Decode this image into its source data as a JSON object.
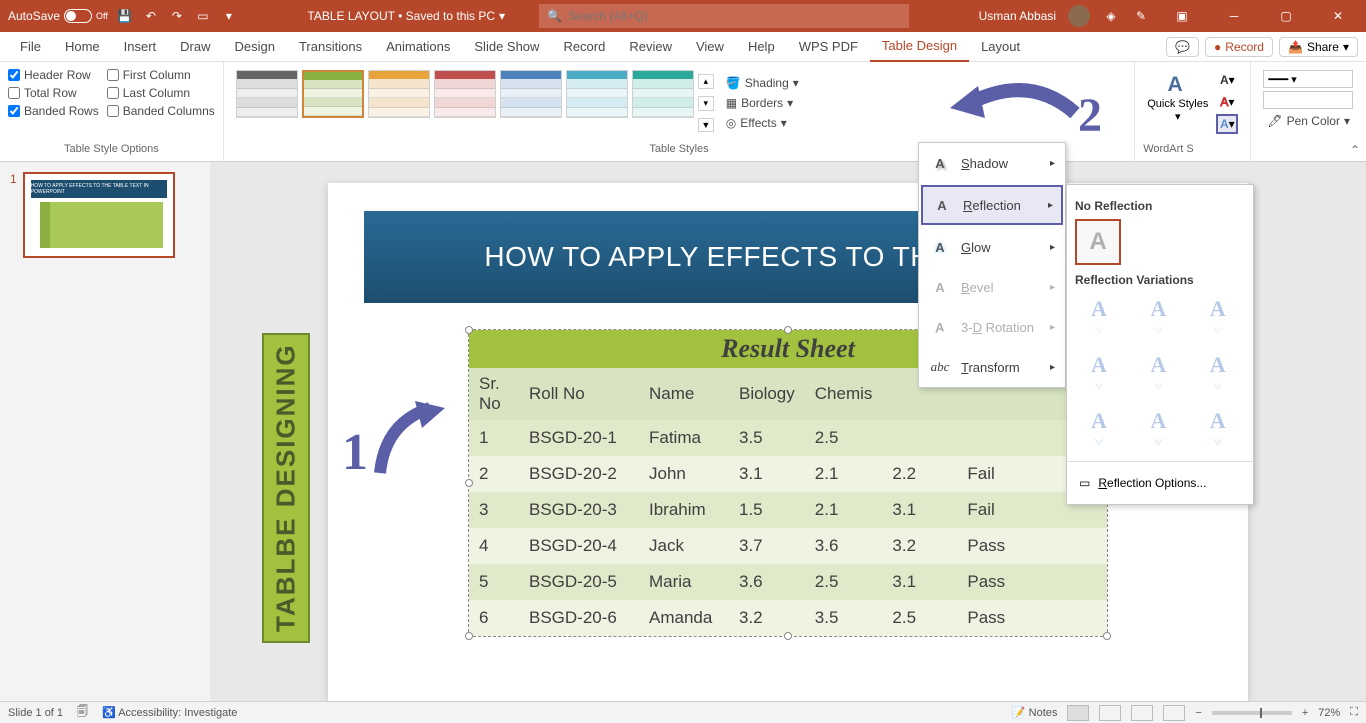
{
  "titleBar": {
    "autosave": "AutoSave",
    "autosaveState": "Off",
    "docTitle": "TABLE LAYOUT • Saved to this PC",
    "searchPlaceholder": "Search (Alt+Q)",
    "userName": "Usman Abbasi"
  },
  "ribbonTabs": [
    "File",
    "Home",
    "Insert",
    "Draw",
    "Design",
    "Transitions",
    "Animations",
    "Slide Show",
    "Record",
    "Review",
    "View",
    "Help",
    "WPS PDF",
    "Table Design",
    "Layout"
  ],
  "activeTab": "Table Design",
  "ribbonRight": {
    "comments": "",
    "record": "Record",
    "share": "Share"
  },
  "tableStyleOptions": {
    "headerRow": "Header Row",
    "totalRow": "Total Row",
    "bandedRows": "Banded Rows",
    "firstColumn": "First Column",
    "lastColumn": "Last Column",
    "bandedColumns": "Banded Columns",
    "label": "Table Style Options"
  },
  "tableStylesLabel": "Table Styles",
  "shading": "Shading",
  "borders": "Borders",
  "effects": "Effects",
  "quickStyles": "Quick Styles",
  "wordArtLabel": "WordArt S",
  "penColor": "Pen Color",
  "effectsMenu": {
    "shadow": "Shadow",
    "reflection": "Reflection",
    "glow": "Glow",
    "bevel": "Bevel",
    "rotation3d": "3-D Rotation",
    "transform": "Transform"
  },
  "reflectionMenu": {
    "noReflection": "No Reflection",
    "variations": "Reflection Variations",
    "options": "Reflection Options..."
  },
  "slide": {
    "title": "HOW TO APPLY EFFECTS TO THE TABLE TE",
    "sideLabel": "TABLBE DESIGNING",
    "resultTitle": "Result  Sheet",
    "headers": [
      "Sr. No",
      "Roll No",
      "Name",
      "Biology",
      "Chemis"
    ],
    "rows": [
      [
        "1",
        "BSGD-20-1",
        "Fatima",
        "3.5",
        "2.5",
        "",
        "",
        ""
      ],
      [
        "2",
        "BSGD-20-2",
        "John",
        "3.1",
        "2.1",
        "2.2",
        "Fail",
        ""
      ],
      [
        "3",
        "BSGD-20-3",
        "Ibrahim",
        "1.5",
        "2.1",
        "3.1",
        "Fail",
        ""
      ],
      [
        "4",
        "BSGD-20-4",
        "Jack",
        "3.7",
        "3.6",
        "3.2",
        "Pass",
        ""
      ],
      [
        "5",
        "BSGD-20-5",
        "Maria",
        "3.6",
        "2.5",
        "3.1",
        "Pass",
        ""
      ],
      [
        "6",
        "BSGD-20-6",
        "Amanda",
        "3.2",
        "3.5",
        "2.5",
        "Pass",
        ""
      ]
    ]
  },
  "thumbPanel": {
    "num": "1"
  },
  "statusBar": {
    "slideInfo": "Slide 1 of 1",
    "accessibility": "Accessibility: Investigate",
    "notes": "Notes",
    "zoom": "72%"
  },
  "annotations": {
    "one": "1",
    "two": "2"
  }
}
